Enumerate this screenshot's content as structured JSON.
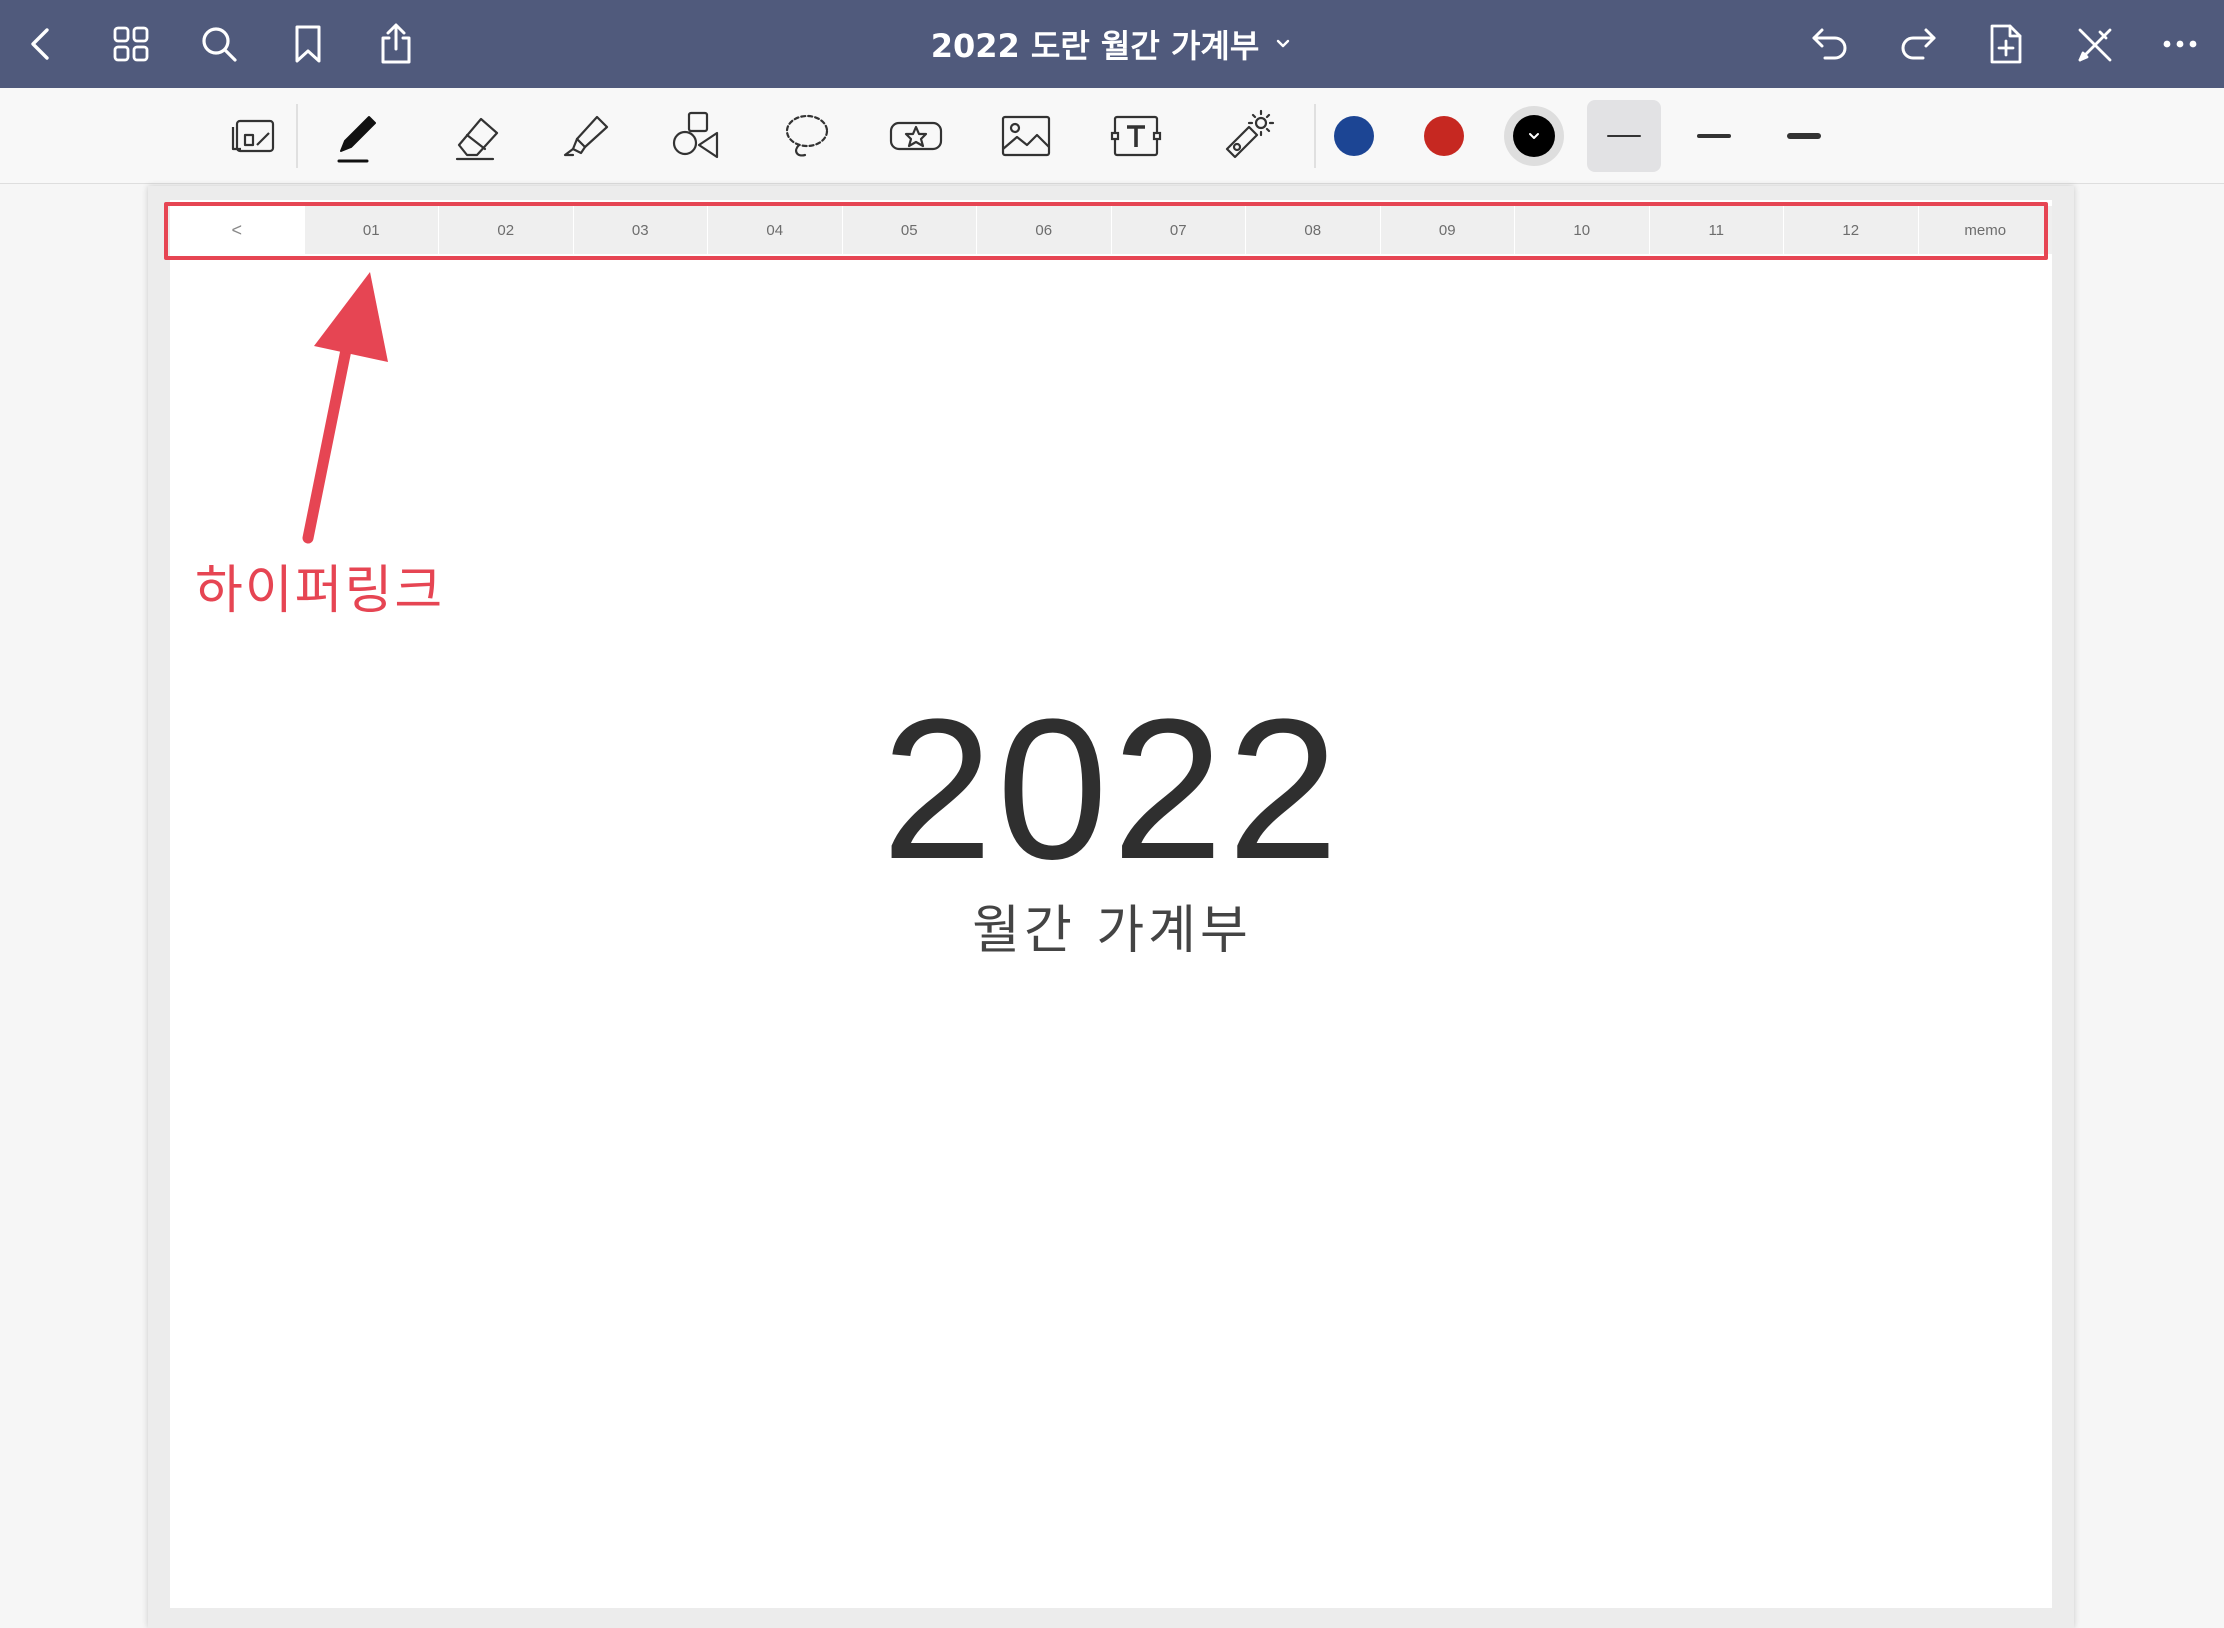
{
  "topbar": {
    "title": "2022 도란 월간 가계부",
    "icons": [
      "back-icon",
      "grid-icon",
      "search-icon",
      "bookmark-icon",
      "share-icon",
      "undo-icon",
      "redo-icon",
      "add-page-icon",
      "pen-off-icon",
      "more-icon"
    ]
  },
  "toolbar": {
    "tools": [
      "page-view-icon",
      "pen-icon",
      "eraser-icon",
      "highlighter-icon",
      "shapes-icon",
      "lasso-icon",
      "sticker-icon",
      "image-icon",
      "text-box-icon",
      "laser-pointer-icon"
    ],
    "colors": [
      "#1c4594",
      "#c62821",
      "#000000"
    ],
    "selected_color": "#000000",
    "bluetooth_indicator": "bluetooth-icon"
  },
  "page": {
    "tabs": [
      "<",
      "01",
      "02",
      "03",
      "04",
      "05",
      "06",
      "07",
      "08",
      "09",
      "10",
      "11",
      "12",
      "memo"
    ],
    "year": "2022",
    "subtitle": "월간 가계부"
  },
  "annotation": {
    "label": "하이퍼링크",
    "color": "#e64553"
  }
}
